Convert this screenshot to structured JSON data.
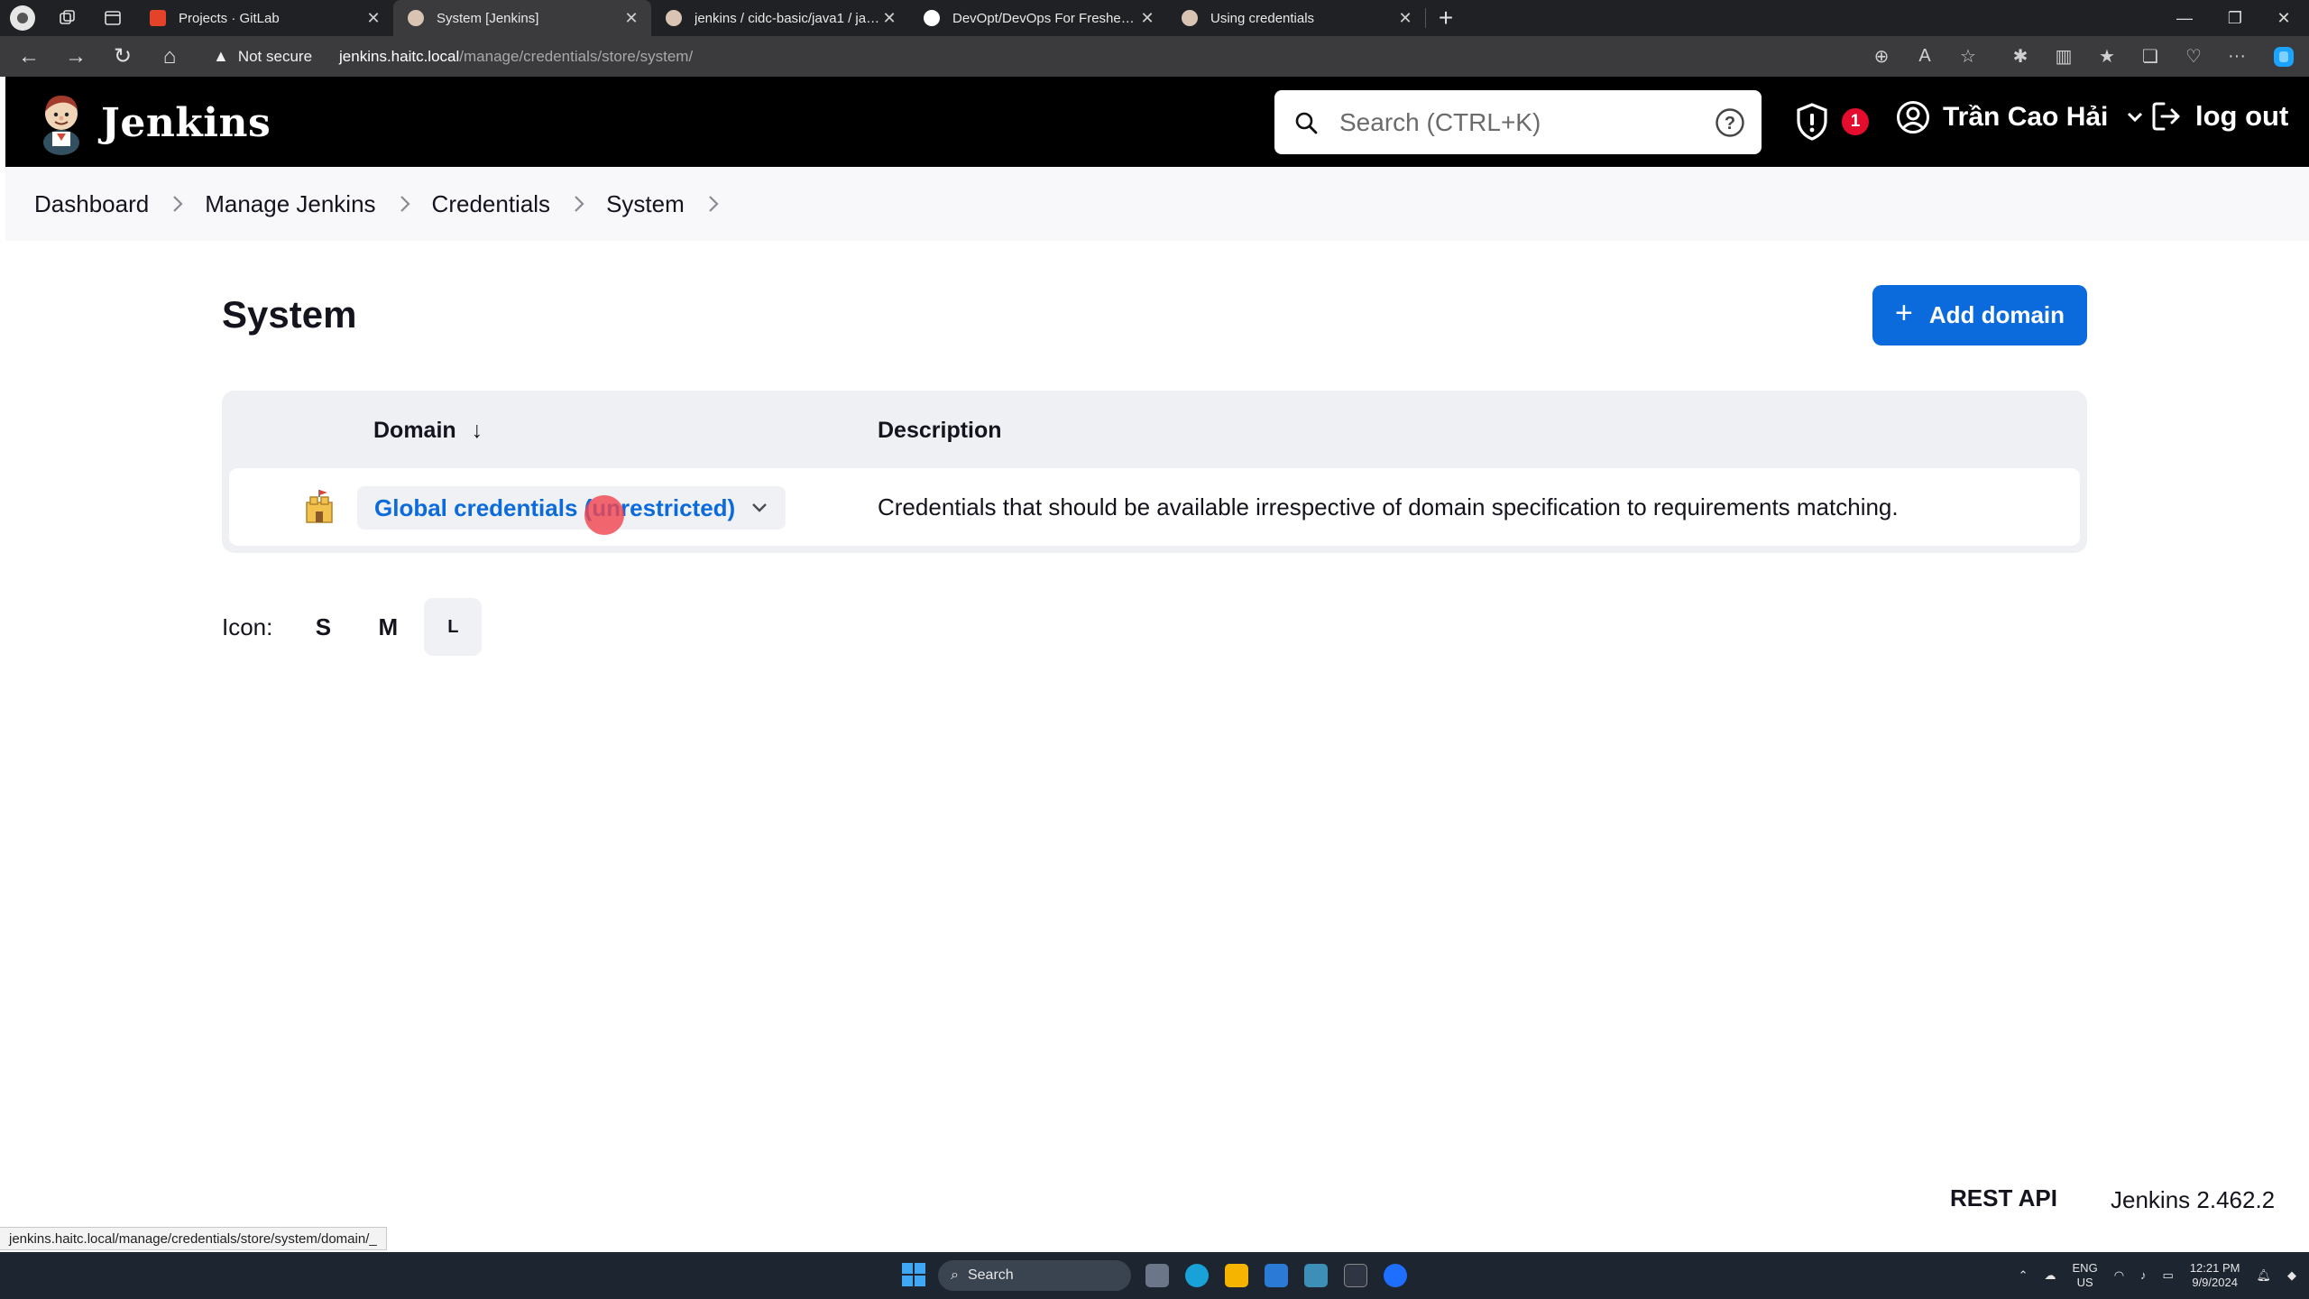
{
  "browser": {
    "tabs": [
      {
        "title": "Projects · GitLab",
        "favicon_color": "#e24329"
      },
      {
        "title": "System [Jenkins]",
        "favicon_color": "#d9c4b4",
        "active": true
      },
      {
        "title": "jenkins / cidc-basic/java1 / java1 /",
        "favicon_color": "#d9c4b4"
      },
      {
        "title": "DevOpt/DevOps For Fresher/6. Je",
        "favicon_color": "#ffffff"
      },
      {
        "title": "Using credentials",
        "favicon_color": "#d9c4b4"
      }
    ],
    "address": {
      "security_label": "Not secure",
      "url_host": "jenkins.haitc.local",
      "url_path": "/manage/credentials/store/system/"
    },
    "status_url": "jenkins.haitc.local/manage/credentials/store/system/domain/_"
  },
  "header": {
    "brand": "Jenkins",
    "search_placeholder": "Search (CTRL+K)",
    "alert_count": "1",
    "user_name": "Trần Cao Hải",
    "logout_label": "log out"
  },
  "breadcrumb": [
    "Dashboard",
    "Manage Jenkins",
    "Credentials",
    "System"
  ],
  "main": {
    "title": "System",
    "add_domain_label": "Add domain",
    "table": {
      "col_domain": "Domain",
      "col_domain_sort": "↓",
      "col_description": "Description",
      "rows": [
        {
          "domain": "Global credentials (unrestricted)",
          "description": "Credentials that should be available irrespective of domain specification to requirements matching."
        }
      ]
    },
    "icon_size": {
      "label": "Icon:",
      "options": [
        "S",
        "M",
        "L"
      ],
      "selected": "L"
    }
  },
  "footer": {
    "rest_api": "REST API",
    "version": "Jenkins 2.462.2"
  },
  "taskbar": {
    "search_label": "Search",
    "lang_top": "ENG",
    "lang_bottom": "US",
    "time": "12:21 PM",
    "date": "9/9/2024"
  },
  "colors": {
    "accent": "#0b6bdc",
    "header_bg": "#000000",
    "alert_badge": "#e50d2d"
  }
}
